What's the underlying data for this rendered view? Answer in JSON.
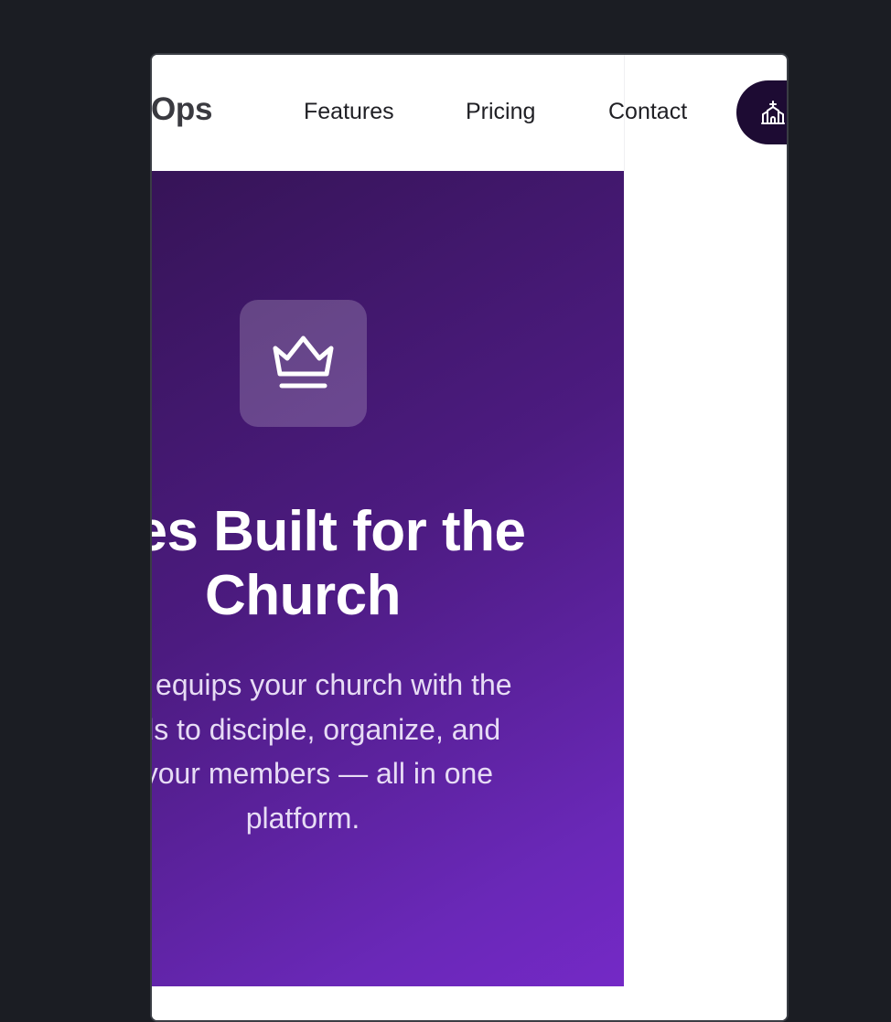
{
  "navbar": {
    "brand": "domOps",
    "links": {
      "features": "Features",
      "pricing": "Pricing",
      "contact": "Contact"
    },
    "cta_icon": "church-icon"
  },
  "hero": {
    "icon": "crown-icon",
    "title_lines": [
      "ures Built for the",
      "Church"
    ],
    "description_lines": [
      "Ops equips your church with the",
      "eeds to disciple, organize, and",
      "ct your members — all in one",
      "platform."
    ]
  },
  "colors": {
    "page_background": "#1b1d23",
    "navbar_background": "#ffffff",
    "cta_background": "#1d0b33",
    "hero_gradient_start": "#361457",
    "hero_gradient_end": "#7429c6",
    "hero_text": "#ffffff"
  }
}
